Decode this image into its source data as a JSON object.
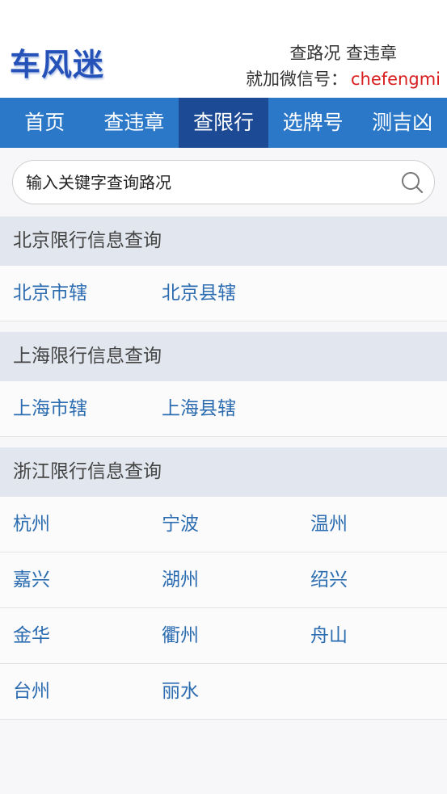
{
  "header": {
    "logo_text": "车风迷",
    "tagline": "查路况 查违章",
    "wechat_label": "就加微信号：",
    "wechat_id": "chefengmi"
  },
  "nav": {
    "items": [
      {
        "label": "首页"
      },
      {
        "label": "查违章"
      },
      {
        "label": "查限行"
      },
      {
        "label": "选牌号"
      },
      {
        "label": "测吉凶"
      }
    ],
    "active_index": 2
  },
  "search": {
    "placeholder": "输入关键字查询路况"
  },
  "sections": [
    {
      "title": "北京限行信息查询",
      "rows": [
        [
          "北京市辖",
          "北京县辖"
        ]
      ]
    },
    {
      "title": "上海限行信息查询",
      "rows": [
        [
          "上海市辖",
          "上海县辖"
        ]
      ]
    },
    {
      "title": "浙江限行信息查询",
      "rows": [
        [
          "杭州",
          "宁波",
          "温州"
        ],
        [
          "嘉兴",
          "湖州",
          "绍兴"
        ],
        [
          "金华",
          "衢州",
          "舟山"
        ],
        [
          "台州",
          "丽水"
        ]
      ]
    }
  ],
  "colors": {
    "nav_bg": "#2b78c8",
    "nav_active_bg": "#1c4a94",
    "link": "#2b6cb0",
    "wechat_id": "#d81e1e",
    "logo": "#2452b8"
  }
}
